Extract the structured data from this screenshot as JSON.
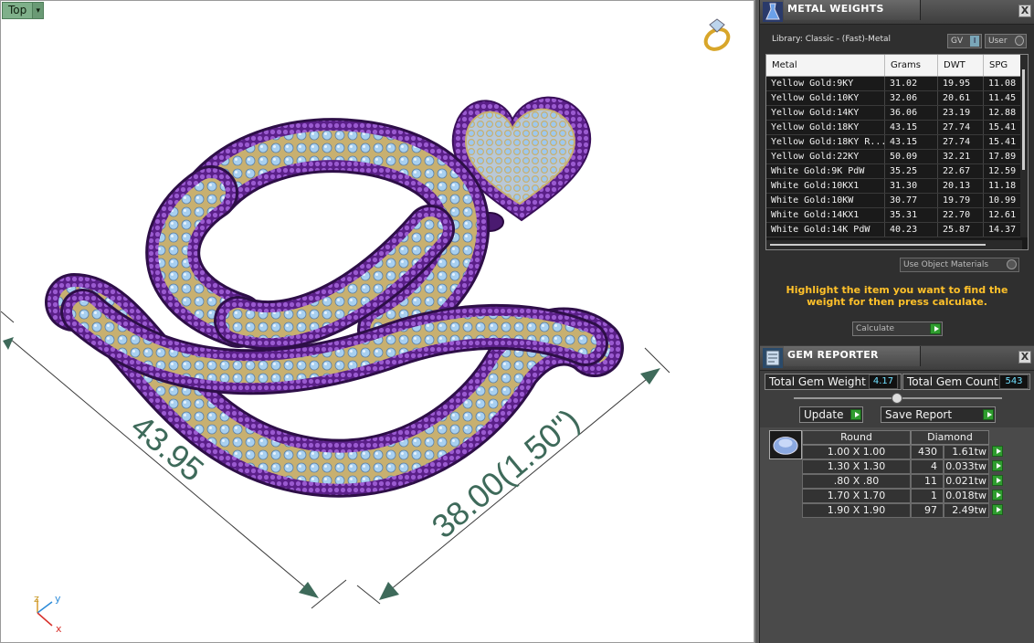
{
  "viewport": {
    "view_name": "Top",
    "dimension_1": "43.95",
    "dimension_2": "38.00(1.50\")",
    "axis_labels": {
      "z": "z",
      "y": "y",
      "x": "x"
    }
  },
  "metal_weights": {
    "title": "METAL WEIGHTS",
    "library": "Library: Classic - (Fast)-Metal",
    "gv_label": "GV",
    "gv_knob": "I",
    "user_label": "User",
    "columns": [
      "Metal",
      "Grams",
      "DWT",
      "SPG"
    ],
    "rows": [
      {
        "metal": "Yellow Gold:9KY",
        "grams": "31.02",
        "dwt": "19.95",
        "spg": "11.08"
      },
      {
        "metal": "Yellow Gold:10KY",
        "grams": "32.06",
        "dwt": "20.61",
        "spg": "11.45"
      },
      {
        "metal": "Yellow Gold:14KY",
        "grams": "36.06",
        "dwt": "23.19",
        "spg": "12.88"
      },
      {
        "metal": "Yellow Gold:18KY",
        "grams": "43.15",
        "dwt": "27.74",
        "spg": "15.41"
      },
      {
        "metal": "Yellow Gold:18KY R...",
        "grams": "43.15",
        "dwt": "27.74",
        "spg": "15.41"
      },
      {
        "metal": "Yellow Gold:22KY",
        "grams": "50.09",
        "dwt": "32.21",
        "spg": "17.89"
      },
      {
        "metal": "White Gold:9K PdW",
        "grams": "35.25",
        "dwt": "22.67",
        "spg": "12.59"
      },
      {
        "metal": "White Gold:10KX1",
        "grams": "31.30",
        "dwt": "20.13",
        "spg": "11.18"
      },
      {
        "metal": "White Gold:10KW",
        "grams": "30.77",
        "dwt": "19.79",
        "spg": "10.99"
      },
      {
        "metal": "White Gold:14KX1",
        "grams": "35.31",
        "dwt": "22.70",
        "spg": "12.61"
      },
      {
        "metal": "White Gold:14K PdW",
        "grams": "40.23",
        "dwt": "25.87",
        "spg": "14.37"
      }
    ],
    "use_object_materials": "Use Object Materials",
    "hint": "Highlight the item you want to find the weight for then press calculate.",
    "calculate_label": "Calculate",
    "close": "X"
  },
  "gem_reporter": {
    "title": "GEM REPORTER",
    "total_weight_label": "Total Gem Weight",
    "total_weight_value": "4.17",
    "total_count_label": "Total Gem Count",
    "total_count_value": "543",
    "update_label": "Update",
    "save_report_label": "Save Report",
    "shape_header": "Round",
    "type_header": "Diamond",
    "rows": [
      {
        "size": "1.00 X 1.00",
        "count": "430",
        "weight": "1.61tw"
      },
      {
        "size": "1.30 X 1.30",
        "count": "4",
        "weight": "0.033tw"
      },
      {
        "size": ".80 X .80",
        "count": "11",
        "weight": "0.021tw"
      },
      {
        "size": "1.70 X 1.70",
        "count": "1",
        "weight": "0.018tw"
      },
      {
        "size": "1.90 X 1.90",
        "count": "97",
        "weight": "2.49tw"
      }
    ],
    "close": "X"
  },
  "colors": {
    "viewport_bg": "#ffffff",
    "metal_purple": "#6a2a9a",
    "gold": "#c8b070",
    "stone_blue": "#9ec8ee",
    "dimension_green": "#3e6a5a",
    "hint_yellow": "#ffc12a",
    "go_green": "#2f9d2f"
  }
}
